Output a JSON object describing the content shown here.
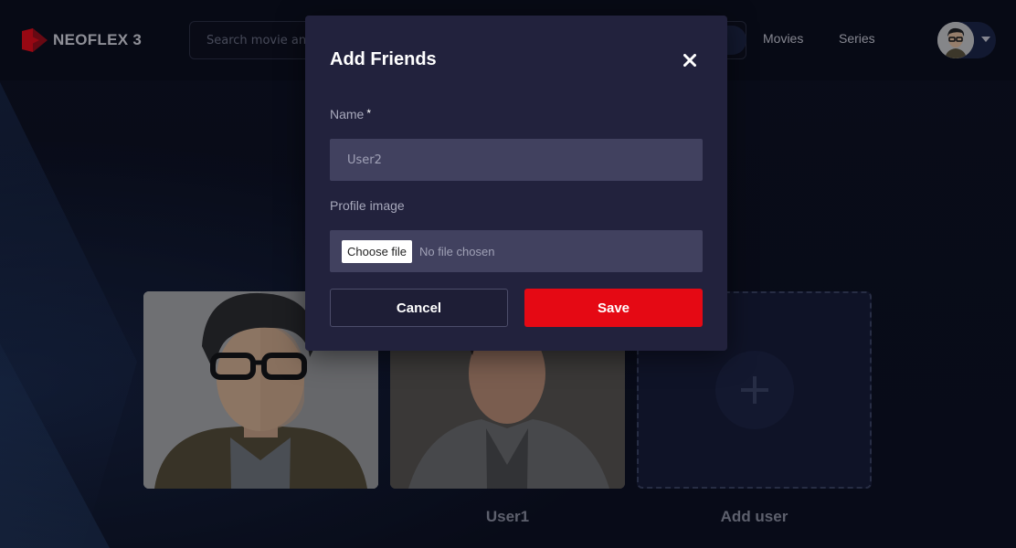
{
  "header": {
    "brand": "NEOFLEX 3",
    "search_placeholder": "Search movie and ...",
    "nav": [
      "Movies",
      "Series"
    ]
  },
  "profiles": [
    {
      "name": ""
    },
    {
      "name": "User1"
    },
    {
      "name": "Add user"
    }
  ],
  "modal": {
    "title": "Add Friends",
    "name_label": "Name",
    "required_mark": "*",
    "name_value": "User2",
    "image_label": "Profile image",
    "file_button": "Choose file",
    "file_status": "No file chosen",
    "cancel_label": "Cancel",
    "save_label": "Save"
  },
  "colors": {
    "accent": "#e50914",
    "modal_bg": "#22223d",
    "input_bg": "#41415f"
  }
}
